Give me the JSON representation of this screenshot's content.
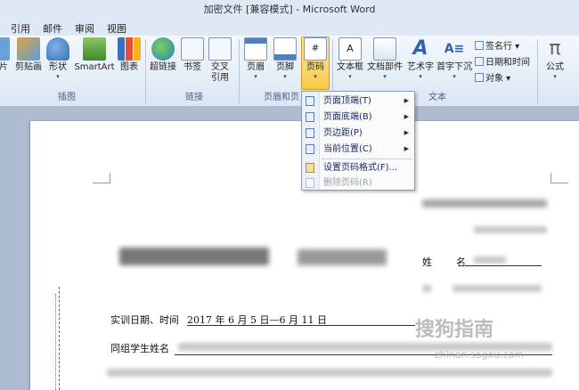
{
  "window": {
    "title": "加密文件 [兼容模式] - Microsoft Word"
  },
  "tabs": [
    "引用",
    "邮件",
    "审阅",
    "视图"
  ],
  "ribbon": {
    "buttons": [
      {
        "label": "片"
      },
      {
        "label": "剪贴画"
      },
      {
        "label": "形状"
      },
      {
        "label": "SmartArt"
      },
      {
        "label": "图表"
      },
      {
        "label": "超链接"
      },
      {
        "label": "书签"
      },
      {
        "label": "交叉",
        "label2": "引用"
      },
      {
        "label": "页眉"
      },
      {
        "label": "页脚"
      },
      {
        "label": "页码"
      },
      {
        "label": "文本框"
      },
      {
        "label": "文档部件"
      },
      {
        "label": "艺术字"
      },
      {
        "label": "首字下沉"
      },
      {
        "label": "公式"
      }
    ],
    "small_buttons": [
      "签名行",
      "日期和时间",
      "对象"
    ],
    "groups": [
      "插图",
      "链接",
      "页眉和页",
      "文本"
    ],
    "pi_glyph": "π"
  },
  "menu": {
    "items": [
      {
        "label": "页面顶端(T)",
        "arrow": "▶",
        "enabled": true
      },
      {
        "label": "页面底端(B)",
        "arrow": "▶",
        "enabled": true
      },
      {
        "label": "页边距(P)",
        "arrow": "▶",
        "enabled": true
      },
      {
        "label": "当前位置(C)",
        "arrow": "▶",
        "enabled": true
      },
      {
        "label": "设置页码格式(F)...",
        "enabled": true
      },
      {
        "label": "删除页码(R)",
        "enabled": false
      }
    ]
  },
  "document": {
    "line1_label": "实训日期、时间",
    "line1_value": "2017 年 6 月 5 日—6 月 11 日",
    "line2_label": "同组学生姓名",
    "name_field_label": "姓",
    "name_field_label2": "名",
    "watermark": "搜狗指南",
    "watermark_sub": "zhinan.sogou.com"
  }
}
